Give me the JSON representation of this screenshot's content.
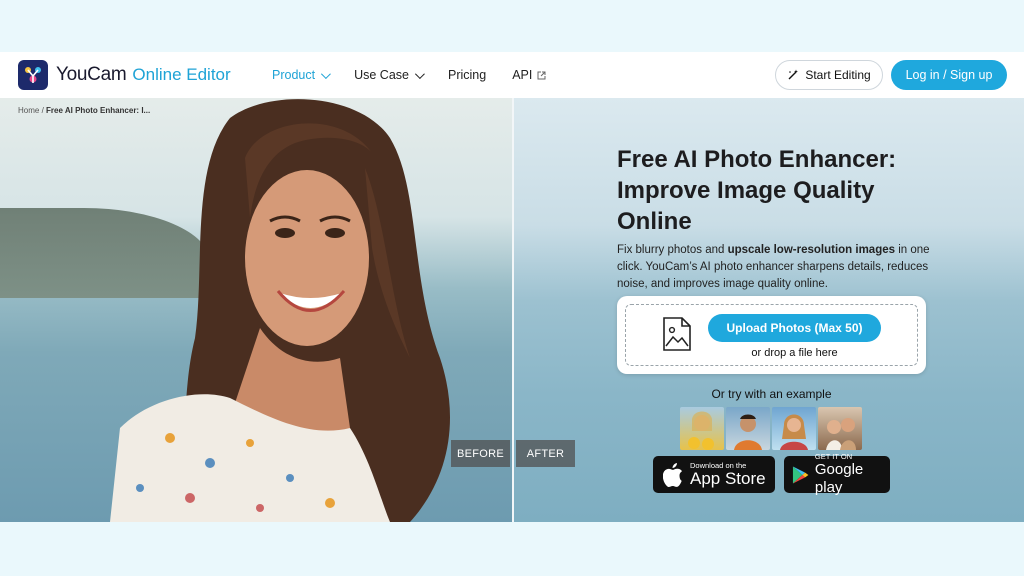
{
  "header": {
    "logo_name": "YouCam",
    "logo_sub": "Online Editor",
    "nav": [
      {
        "label": "Product"
      },
      {
        "label": "Use Case"
      },
      {
        "label": "Pricing"
      },
      {
        "label": "API"
      }
    ],
    "start_editing": "Start Editing",
    "login": "Log in / Sign up"
  },
  "breadcrumb": {
    "home": "Home",
    "sep": "/",
    "current": "Free AI Photo Enhancer: I..."
  },
  "hero": {
    "title": "Free AI Photo Enhancer: Improve Image Quality Online",
    "desc_a": "Fix blurry photos and ",
    "desc_b": "upscale low-resolution images",
    "desc_c": " in one click. YouCam’s AI photo enhancer sharpens details, reduces noise, and improves image quality online.",
    "upload_button": "Upload Photos (Max 50)",
    "drop_text": "or drop a file here",
    "try_text": "Or try with an example",
    "before_label": "BEFORE",
    "after_label": "AFTER"
  },
  "stores": {
    "apple_small": "Download on the",
    "apple_big": "App Store",
    "google_small": "GET IT ON",
    "google_big": "Google play"
  },
  "colors": {
    "accent": "#1fa8dd",
    "logo_bg": "#1d2a6b"
  }
}
